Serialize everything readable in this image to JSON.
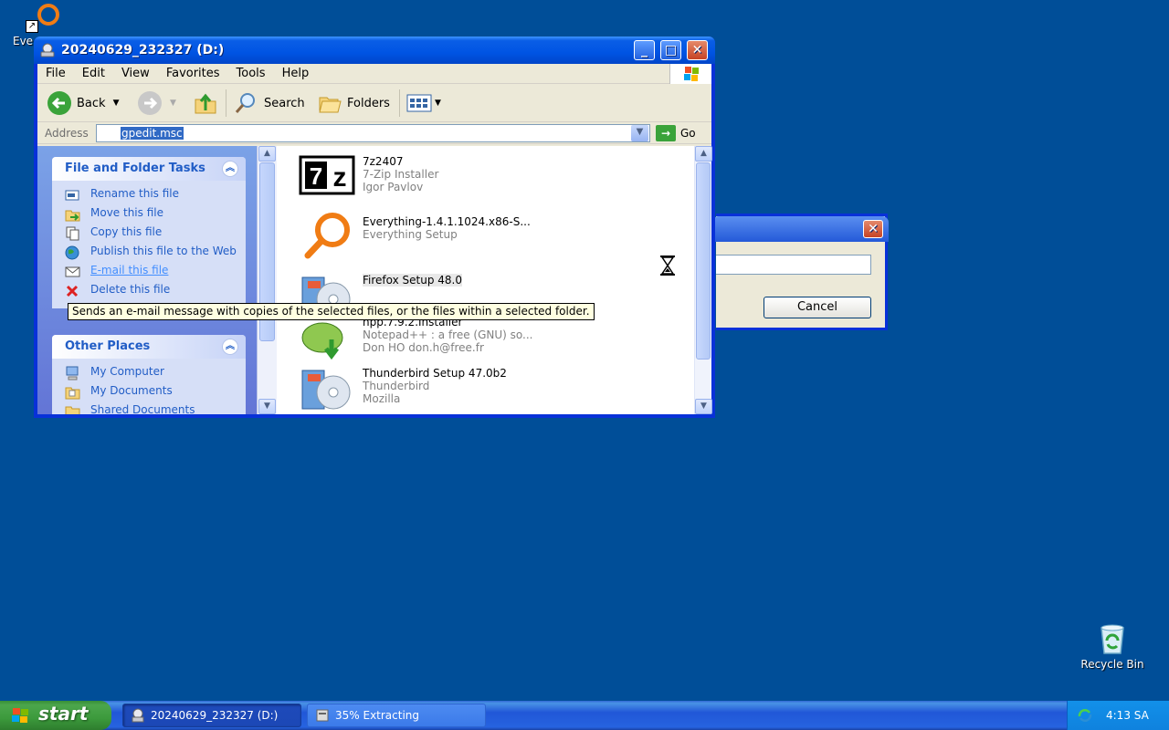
{
  "desktop": {
    "everything_label": "Eve",
    "recycle_bin_label": "Recycle Bin"
  },
  "window": {
    "title": "20240629_232327 (D:)",
    "menu": [
      "File",
      "Edit",
      "View",
      "Favorites",
      "Tools",
      "Help"
    ],
    "toolbar": {
      "back": "Back",
      "search": "Search",
      "folders": "Folders"
    },
    "address": {
      "label": "Address",
      "value": "gpedit.msc",
      "go": "Go"
    }
  },
  "taskpane": {
    "file_tasks": {
      "title": "File and Folder Tasks",
      "items": [
        "Rename this file",
        "Move this file",
        "Copy this file",
        "Publish this file to the Web",
        "E-mail this file",
        "Delete this file"
      ]
    },
    "other_places": {
      "title": "Other Places",
      "items": [
        "My Computer",
        "My Documents",
        "Shared Documents"
      ]
    }
  },
  "files": [
    {
      "name": "7z2407",
      "line2": "7-Zip Installer",
      "line3": "Igor Pavlov"
    },
    {
      "name": "Everything-1.4.1.1024.x86-S...",
      "line2": "Everything Setup",
      "line3": ""
    },
    {
      "name": "Firefox Setup 48.0",
      "line2": "",
      "line3": ""
    },
    {
      "name": "npp.7.9.2.Installer",
      "line2": "Notepad++ : a free (GNU) so...",
      "line3": "Don HO don.h@free.fr"
    },
    {
      "name": "Thunderbird Setup 47.0b2",
      "line2": "Thunderbird",
      "line3": "Mozilla"
    }
  ],
  "tooltip": "Sends an e-mail message with copies of the selected files, or the files within a selected folder.",
  "extract_dialog": {
    "cancel": "Cancel"
  },
  "taskbar": {
    "start": "start",
    "tasks": [
      "20240629_232327 (D:)",
      "35% Extracting"
    ],
    "clock": "4:13 SA"
  },
  "extract_progress_percent": 35
}
